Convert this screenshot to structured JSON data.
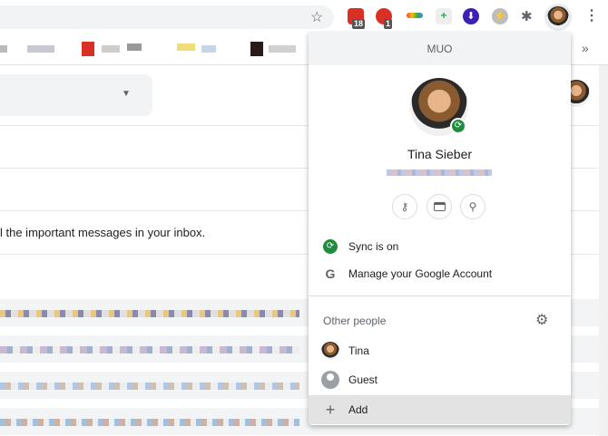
{
  "toolbar": {
    "extensions": [
      {
        "name": "calendar-extension",
        "badge": "18",
        "color": "#d93025"
      },
      {
        "name": "hand-extension",
        "badge": "1",
        "color": "#d93025"
      },
      {
        "name": "rainbow-extension",
        "color": "#4285f4"
      },
      {
        "name": "plus-doc-extension",
        "color": "#34a853"
      },
      {
        "name": "download-extension",
        "color": "#3c1fb5"
      },
      {
        "name": "bolt-extension",
        "color": "#bdbdbd"
      }
    ]
  },
  "gmail": {
    "inbox_hint": "l the important messages in your inbox."
  },
  "profile_menu": {
    "header": "MUO",
    "name": "Tina Sieber",
    "sync_label": "Sync is on",
    "manage_label": "Manage your Google Account",
    "other_people_label": "Other people",
    "people": [
      {
        "label": "Tina"
      },
      {
        "label": "Guest"
      }
    ],
    "add_label": "Add",
    "sync_color": "#1e8e3e"
  }
}
